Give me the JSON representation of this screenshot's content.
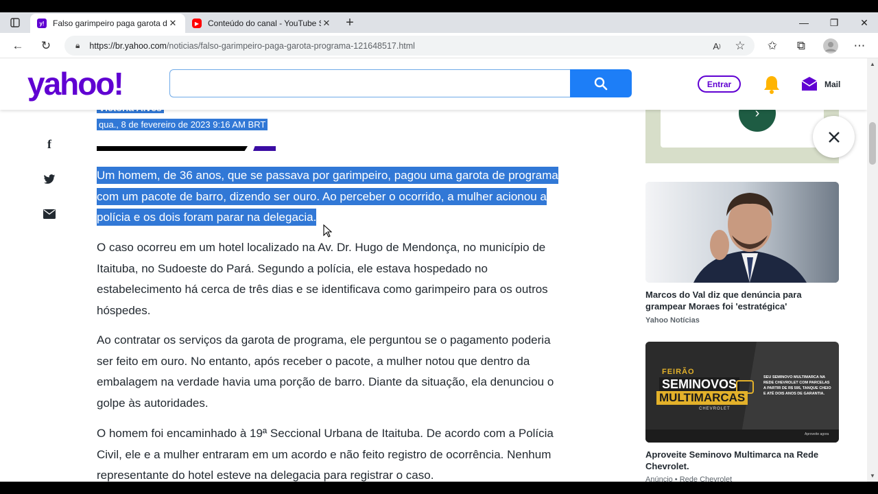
{
  "browser": {
    "tabs": [
      {
        "title": "Falso garimpeiro paga garota de",
        "active": true
      },
      {
        "title": "Conteúdo do canal - YouTube St",
        "active": false
      }
    ],
    "url_host": "https://br.yahoo.com",
    "url_path": "/noticias/falso-garimpeiro-paga-garota-programa-121648517.html"
  },
  "header": {
    "logo": "yahoo!",
    "search_placeholder": "",
    "signin_label": "Entrar",
    "mail_label": "Mail"
  },
  "article": {
    "author": "Victória Alves",
    "date": "qua., 8 de fevereiro de 2023 9:16 AM BRT",
    "lead_lines": [
      "Um homem, de 36 anos, que se passava por garimpeiro, pagou uma garota de programa",
      "com um pacote de barro, dizendo ser ouro. Ao perceber o ocorrido, a mulher acionou a",
      "polícia e os dois foram parar na delegacia."
    ],
    "paragraphs": [
      [
        "O caso ocorreu em um hotel localizado na Av. Dr. Hugo de Mendonça, no município de",
        "Itaituba, no Sudoeste do Pará. Segundo a polícia, ele estava hospedado no",
        "estabelecimento há cerca de três dias e se identificava como garimpeiro para os outros",
        "hóspedes."
      ],
      [
        "Ao contratar os serviços da garota de programa, ele perguntou se o pagamento poderia",
        "ser feito em ouro. No entanto, após receber o pacote, a mulher notou que dentro da",
        "embalagem na verdade havia uma porção de barro. Diante da situação, ela denunciou o",
        "golpe às autoridades."
      ],
      [
        "O homem foi encaminhado à 19ª Seccional Urbana de Itaituba. De acordo com a Polícia",
        "Civil, ele e a mulher entraram em um acordo e não feito registro de ocorrência. Nenhum",
        "representante do hotel esteve na delegacia para registrar o caso."
      ]
    ]
  },
  "sidebar": {
    "card1": {
      "title": "Marcos do Val diz que denúncia para grampear Moraes foi 'estratégica'",
      "source": "Yahoo Notícias"
    },
    "card2": {
      "title": "Aproveite Seminovo Multimarca na Rede Chevrolet.",
      "source": "Anúncio • Rede Chevrolet",
      "ad_kicker": "FEIRÃO",
      "ad_line1": "SEMINOVOS",
      "ad_line2": "MULTIMARCAS",
      "ad_brand": "CHEVROLET",
      "ad_copy": "SEU SEMINOVO MULTIMARCA NA REDE CHEVROLET COM PARCELAS A PARTIR DE R$ 595, TANQUE CHEIO E ATÉ DOIS ANOS DE GARANTIA.",
      "ad_cta": "Aproveite agora"
    }
  },
  "colors": {
    "brand": "#6001d2",
    "selection": "#3178d6",
    "search_btn": "#1d7ef7"
  }
}
